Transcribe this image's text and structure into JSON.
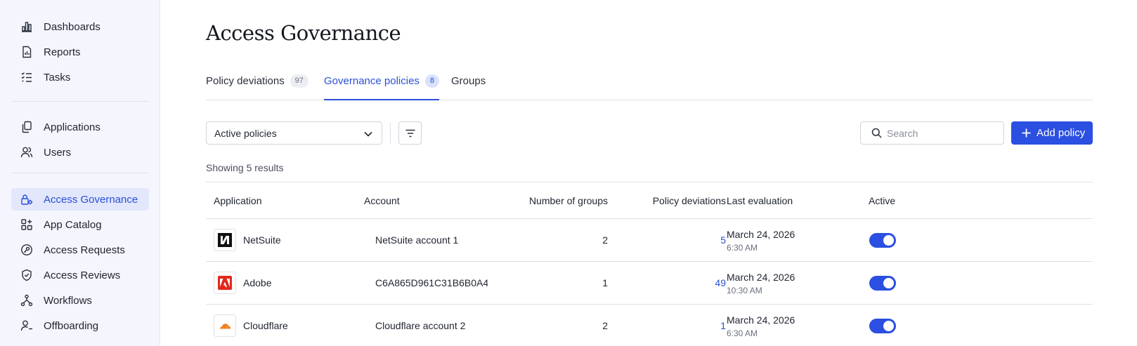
{
  "sidebar": {
    "group1": [
      {
        "label": "Dashboards",
        "icon": "bar-chart-icon"
      },
      {
        "label": "Reports",
        "icon": "report-icon"
      },
      {
        "label": "Tasks",
        "icon": "task-list-icon"
      }
    ],
    "group2": [
      {
        "label": "Applications",
        "icon": "applications-icon"
      },
      {
        "label": "Users",
        "icon": "users-icon"
      }
    ],
    "group3": [
      {
        "label": "Access Governance",
        "icon": "lock-gear-icon",
        "active": true
      },
      {
        "label": "App Catalog",
        "icon": "grid-plus-icon"
      },
      {
        "label": "Access Requests",
        "icon": "key-circle-icon"
      },
      {
        "label": "Access Reviews",
        "icon": "shield-check-icon"
      },
      {
        "label": "Workflows",
        "icon": "workflow-icon"
      },
      {
        "label": "Offboarding",
        "icon": "user-minus-icon"
      }
    ]
  },
  "page": {
    "title": "Access Governance",
    "tabs": [
      {
        "label": "Policy deviations",
        "count": "97"
      },
      {
        "label": "Governance policies",
        "count": "8",
        "active": true
      },
      {
        "label": "Groups"
      }
    ]
  },
  "toolbar": {
    "filter_select": "Active policies",
    "search_placeholder": "Search",
    "add_label": "Add policy"
  },
  "results_text": "Showing 5 results",
  "table": {
    "headers": [
      "Application",
      "Account",
      "Number of groups",
      "Policy deviations",
      "Last evaluation",
      "Active"
    ],
    "rows": [
      {
        "app": "NetSuite",
        "account": "NetSuite account 1",
        "groups": "2",
        "deviations": "5",
        "date": "March 24, 2026",
        "time": "6:30 AM",
        "active": true
      },
      {
        "app": "Adobe",
        "account": "C6A865D961C31B6B0A4",
        "groups": "1",
        "deviations": "49",
        "date": "March 24, 2026",
        "time": "10:30 AM",
        "active": true
      },
      {
        "app": "Cloudflare",
        "account": "Cloudflare account 2",
        "groups": "2",
        "deviations": "1",
        "date": "March 24, 2026",
        "time": "6:30 AM",
        "active": true
      }
    ]
  },
  "colors": {
    "accent": "#2b4fe0",
    "sidebar_bg": "#f5f6fd",
    "active_nav_bg": "#e2e7fc"
  }
}
